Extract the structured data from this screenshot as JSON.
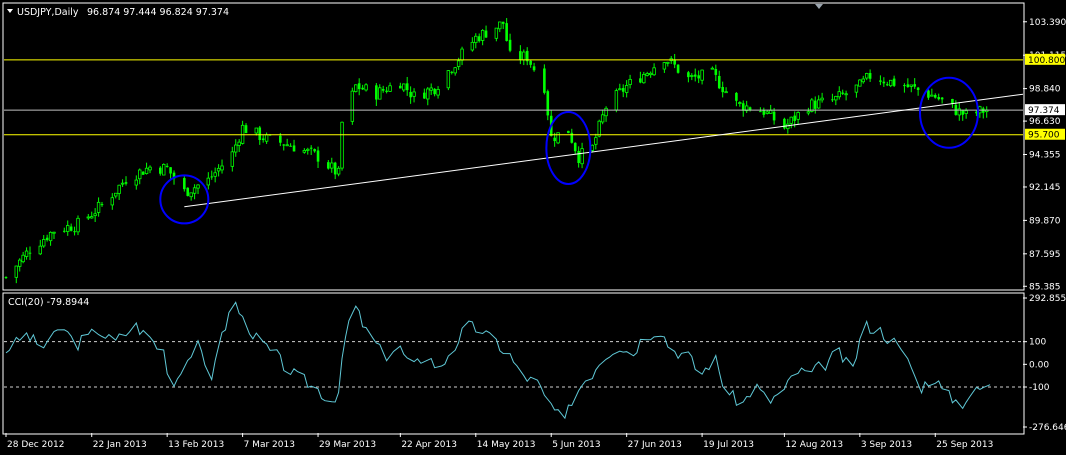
{
  "chart_data": [
    {
      "type": "candlestick",
      "symbol_label": "USDJPY,Daily",
      "ohlc_label": "96.874 97.444 96.824 97.374",
      "y_ticks": [
        "103.390",
        "101.115",
        "98.840",
        "96.630",
        "94.355",
        "92.145",
        "89.870",
        "87.595",
        "85.385"
      ],
      "y_tick_values": [
        103.39,
        101.115,
        98.84,
        96.63,
        94.355,
        92.145,
        89.87,
        87.595,
        85.385
      ],
      "ylim": [
        85.2,
        104.6
      ],
      "horizontal_levels": [
        {
          "value": 100.8,
          "label": "100.800",
          "color": "#ffff00"
        },
        {
          "value": 95.7,
          "label": "95.700",
          "color": "#ffff00"
        }
      ],
      "current_price": {
        "value": 97.374,
        "label": "97.374",
        "color": "#c0c0c0"
      },
      "trendline": {
        "points": [
          {
            "date": "2013-02-18",
            "y": 90.8
          },
          {
            "date": "2013-10-20",
            "y": 98.46
          }
        ],
        "color": "#ffffff"
      },
      "highlight_circles": [
        {
          "date": "2013-02-18",
          "y": 91.3
        },
        {
          "date": "2013-06-10",
          "y": 94.8
        },
        {
          "date": "2013-09-29",
          "y": 97.2
        }
      ],
      "close_path": [
        [
          "2012-12-28",
          86.0
        ],
        [
          "2013-01-04",
          87.9
        ],
        [
          "2013-01-11",
          89.2
        ],
        [
          "2013-01-18",
          89.6
        ],
        [
          "2013-01-25",
          90.9
        ],
        [
          "2013-02-01",
          92.7
        ],
        [
          "2013-02-08",
          93.5
        ],
        [
          "2013-02-13",
          93.4
        ],
        [
          "2013-02-18",
          91.8
        ],
        [
          "2013-02-25",
          92.6
        ],
        [
          "2013-03-04",
          94.4
        ],
        [
          "2013-03-07",
          96.2
        ],
        [
          "2013-03-14",
          95.4
        ],
        [
          "2013-03-21",
          95.0
        ],
        [
          "2013-03-29",
          94.2
        ],
        [
          "2013-04-04",
          93.0
        ],
        [
          "2013-04-05",
          96.5
        ],
        [
          "2013-04-09",
          99.0
        ],
        [
          "2013-04-15",
          98.5
        ],
        [
          "2013-04-22",
          99.3
        ],
        [
          "2013-04-26",
          98.3
        ],
        [
          "2013-05-02",
          98.9
        ],
        [
          "2013-05-09",
          100.9
        ],
        [
          "2013-05-14",
          102.3
        ],
        [
          "2013-05-22",
          103.3
        ],
        [
          "2013-05-24",
          101.0
        ],
        [
          "2013-05-29",
          101.0
        ],
        [
          "2013-06-03",
          99.0
        ],
        [
          "2013-06-05",
          95.5
        ],
        [
          "2013-06-10",
          96.0
        ],
        [
          "2013-06-13",
          94.2
        ],
        [
          "2013-06-17",
          94.8
        ],
        [
          "2013-06-21",
          97.6
        ],
        [
          "2013-06-27",
          99.0
        ],
        [
          "2013-07-03",
          100.0
        ],
        [
          "2013-07-08",
          101.0
        ],
        [
          "2013-07-15",
          99.5
        ],
        [
          "2013-07-22",
          99.8
        ],
        [
          "2013-07-29",
          97.8
        ],
        [
          "2013-08-06",
          97.3
        ],
        [
          "2013-08-12",
          96.2
        ],
        [
          "2013-08-19",
          97.7
        ],
        [
          "2013-08-26",
          98.0
        ],
        [
          "2013-09-03",
          99.0
        ],
        [
          "2013-09-06",
          99.7
        ],
        [
          "2013-09-12",
          99.3
        ],
        [
          "2013-09-18",
          98.9
        ],
        [
          "2013-09-25",
          98.3
        ],
        [
          "2013-09-30",
          97.5
        ],
        [
          "2013-10-04",
          97.0
        ],
        [
          "2013-10-10",
          97.4
        ]
      ]
    },
    {
      "type": "line",
      "indicator_label": "CCI(20) -79.8944",
      "y_ticks": [
        "292.8552",
        "100",
        "0.00",
        "-100",
        "-276.646"
      ],
      "y_tick_values": [
        292.8552,
        100,
        0,
        -100,
        -276.646
      ],
      "ylim": [
        -276.646,
        292.8552
      ],
      "dashed_levels": [
        100,
        -100
      ],
      "series": [
        {
          "color": "#5fc8d6",
          "points": [
            [
              "2012-12-28",
              60
            ],
            [
              "2013-01-03",
              130
            ],
            [
              "2013-01-08",
              80
            ],
            [
              "2013-01-14",
              160
            ],
            [
              "2013-01-18",
              90
            ],
            [
              "2013-01-24",
              150
            ],
            [
              "2013-01-29",
              100
            ],
            [
              "2013-02-04",
              170
            ],
            [
              "2013-02-08",
              120
            ],
            [
              "2013-02-12",
              60
            ],
            [
              "2013-02-15",
              -90
            ],
            [
              "2013-02-19",
              20
            ],
            [
              "2013-02-22",
              80
            ],
            [
              "2013-02-26",
              -50
            ],
            [
              "2013-03-01",
              120
            ],
            [
              "2013-03-05",
              270
            ],
            [
              "2013-03-09",
              160
            ],
            [
              "2013-03-13",
              90
            ],
            [
              "2013-03-17",
              40
            ],
            [
              "2013-03-21",
              -30
            ],
            [
              "2013-03-25",
              -70
            ],
            [
              "2013-03-29",
              -110
            ],
            [
              "2013-04-02",
              -160
            ],
            [
              "2013-04-04",
              -120
            ],
            [
              "2013-04-06",
              120
            ],
            [
              "2013-04-09",
              250
            ],
            [
              "2013-04-14",
              110
            ],
            [
              "2013-04-18",
              40
            ],
            [
              "2013-04-22",
              70
            ],
            [
              "2013-04-26",
              -10
            ],
            [
              "2013-04-30",
              40
            ],
            [
              "2013-05-04",
              -20
            ],
            [
              "2013-05-08",
              80
            ],
            [
              "2013-05-12",
              170
            ],
            [
              "2013-05-16",
              150
            ],
            [
              "2013-05-20",
              100
            ],
            [
              "2013-05-24",
              40
            ],
            [
              "2013-05-28",
              -50
            ],
            [
              "2013-06-01",
              -80
            ],
            [
              "2013-06-05",
              -180
            ],
            [
              "2013-06-09",
              -250
            ],
            [
              "2013-06-13",
              -110
            ],
            [
              "2013-06-17",
              -40
            ],
            [
              "2013-06-21",
              40
            ],
            [
              "2013-06-25",
              80
            ],
            [
              "2013-06-29",
              50
            ],
            [
              "2013-07-03",
              130
            ],
            [
              "2013-07-07",
              150
            ],
            [
              "2013-07-11",
              60
            ],
            [
              "2013-07-15",
              40
            ],
            [
              "2013-07-19",
              -40
            ],
            [
              "2013-07-23",
              20
            ],
            [
              "2013-07-27",
              -130
            ],
            [
              "2013-07-31",
              -170
            ],
            [
              "2013-08-04",
              -100
            ],
            [
              "2013-08-08",
              -160
            ],
            [
              "2013-08-12",
              -120
            ],
            [
              "2013-08-16",
              -30
            ],
            [
              "2013-08-20",
              -40
            ],
            [
              "2013-08-24",
              0
            ],
            [
              "2013-08-28",
              50
            ],
            [
              "2013-09-01",
              -20
            ],
            [
              "2013-09-05",
              170
            ],
            [
              "2013-09-09",
              150
            ],
            [
              "2013-09-13",
              100
            ],
            [
              "2013-09-17",
              30
            ],
            [
              "2013-09-21",
              -100
            ],
            [
              "2013-09-25",
              -60
            ],
            [
              "2013-09-29",
              -140
            ],
            [
              "2013-10-03",
              -170
            ],
            [
              "2013-10-07",
              -120
            ],
            [
              "2013-10-11",
              -90
            ]
          ]
        }
      ]
    }
  ],
  "x_axis": {
    "tick_labels": [
      {
        "date": "2012-12-28",
        "label": "28 Dec 2012"
      },
      {
        "date": "2013-01-22",
        "label": "22 Jan 2013"
      },
      {
        "date": "2013-02-13",
        "label": "13 Feb 2013"
      },
      {
        "date": "2013-03-07",
        "label": "7 Mar 2013"
      },
      {
        "date": "2013-03-29",
        "label": "29 Mar 2013"
      },
      {
        "date": "2013-04-22",
        "label": "22 Apr 2013"
      },
      {
        "date": "2013-05-14",
        "label": "14 May 2013"
      },
      {
        "date": "2013-06-05",
        "label": "5 Jun 2013"
      },
      {
        "date": "2013-06-27",
        "label": "27 Jun 2013"
      },
      {
        "date": "2013-07-19",
        "label": "19 Jul 2013"
      },
      {
        "date": "2013-08-12",
        "label": "12 Aug 2013"
      },
      {
        "date": "2013-09-03",
        "label": "3 Sep 2013"
      },
      {
        "date": "2013-09-25",
        "label": "25 Sep 2013"
      }
    ],
    "range": [
      "2012-12-28",
      "2013-10-20"
    ]
  },
  "colors": {
    "background": "#000000",
    "axis": "#ffffff",
    "candle": "#00ff00",
    "level_line": "#ffff00",
    "circle": "#0000ff",
    "cci": "#5fc8d6"
  }
}
